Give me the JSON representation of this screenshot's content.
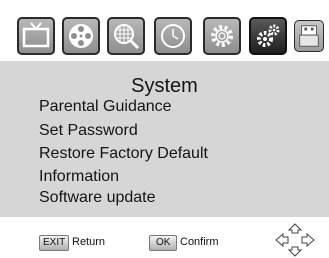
{
  "tabs": [
    {
      "icon": "tv-icon",
      "selected": false
    },
    {
      "icon": "film-reel-icon",
      "selected": false
    },
    {
      "icon": "satellite-dish-icon",
      "selected": false
    },
    {
      "icon": "clock-icon",
      "selected": false
    },
    {
      "icon": "settings-gear-icon",
      "selected": false
    },
    {
      "icon": "system-gears-icon",
      "selected": true
    },
    {
      "icon": "usb-drive-icon",
      "selected": false
    }
  ],
  "menu": {
    "title": "System",
    "items": [
      "Parental Guidance",
      "Set Password",
      "Restore Factory Default",
      "Information",
      "Software update"
    ]
  },
  "footer": {
    "exit_key": "EXIT",
    "exit_label": "Return",
    "ok_key": "OK",
    "ok_label": "Confirm",
    "nav_icon": "navigation-arrows-icon"
  },
  "colors": {
    "panel": "#d6d6d6",
    "tile": "#a6a6a6",
    "active_tile": "#2f2f2f"
  }
}
